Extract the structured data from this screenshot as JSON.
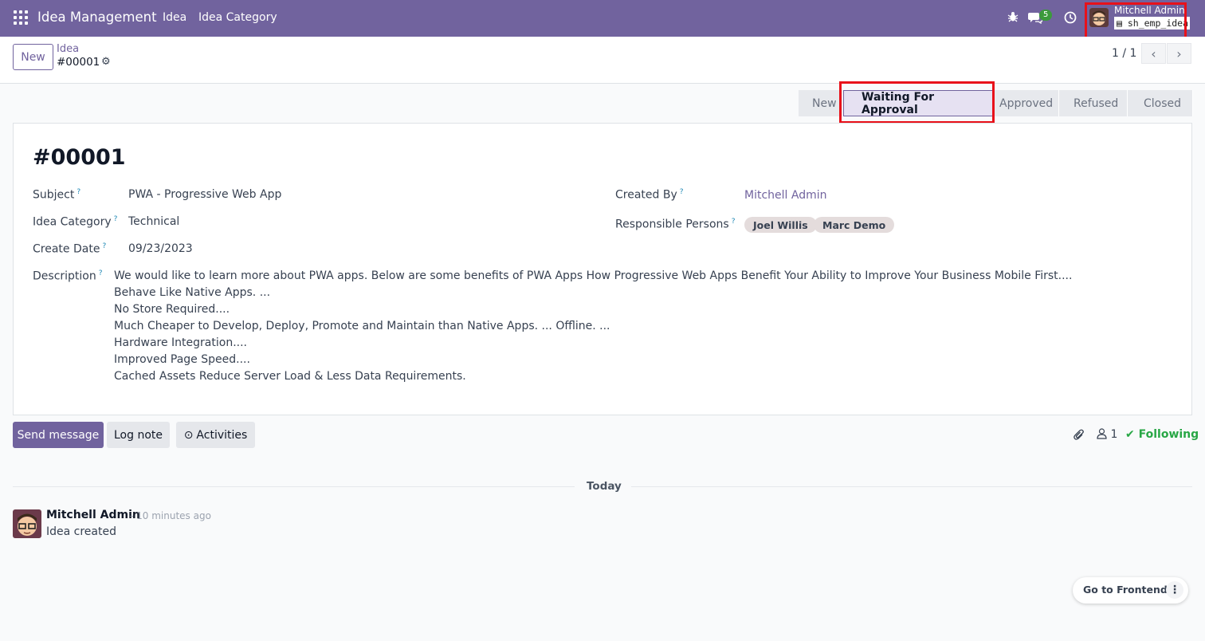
{
  "navbar": {
    "brand": "Idea Management",
    "menu": [
      "Idea",
      "Idea Category"
    ],
    "messages_badge": "5",
    "user_name": "Mitchell Admin",
    "database": "sh_emp_idea"
  },
  "control_panel": {
    "new_label": "New",
    "breadcrumb_parent": "Idea",
    "breadcrumb_current": "#00001",
    "pager_value": "1 / 1"
  },
  "stages": [
    "New",
    "Waiting For Approval",
    "Approved",
    "Refused",
    "Closed"
  ],
  "active_stage": "Waiting For Approval",
  "record": {
    "name": "#00001",
    "subject_label": "Subject",
    "subject": "PWA - Progressive Web App",
    "category_label": "Idea Category",
    "category": "Technical",
    "create_date_label": "Create Date",
    "create_date": "09/23/2023",
    "created_by_label": "Created By",
    "created_by": "Mitchell Admin",
    "responsible_label": "Responsible Persons",
    "responsible": [
      "Joel Willis",
      "Marc Demo"
    ],
    "description_label": "Description",
    "help_mark": "?",
    "description_lines": [
      "We would like to learn more about PWA apps. Below are some benefits of PWA Apps How Progressive Web Apps Benefit Your Ability to Improve Your Business Mobile First....",
      "Behave Like Native Apps. ...",
      "No Store Required....",
      "Much Cheaper to Develop, Deploy, Promote and Maintain than Native Apps. ... Offline. ...",
      "Hardware Integration....",
      "Improved Page Speed....",
      "Cached Assets Reduce Server Load & Less Data Requirements."
    ]
  },
  "chatter": {
    "send_message": "Send message",
    "log_note": "Log note",
    "activities": "Activities",
    "followers_count": "1",
    "following": "Following",
    "date_separator": "Today",
    "message": {
      "author": "Mitchell Admin",
      "date": "- 10 minutes ago",
      "body": "Idea created"
    }
  },
  "frontend_button": "Go to Frontend",
  "colors": {
    "brand": "#71639e",
    "highlight": "#e8111a",
    "following": "#28a745"
  }
}
